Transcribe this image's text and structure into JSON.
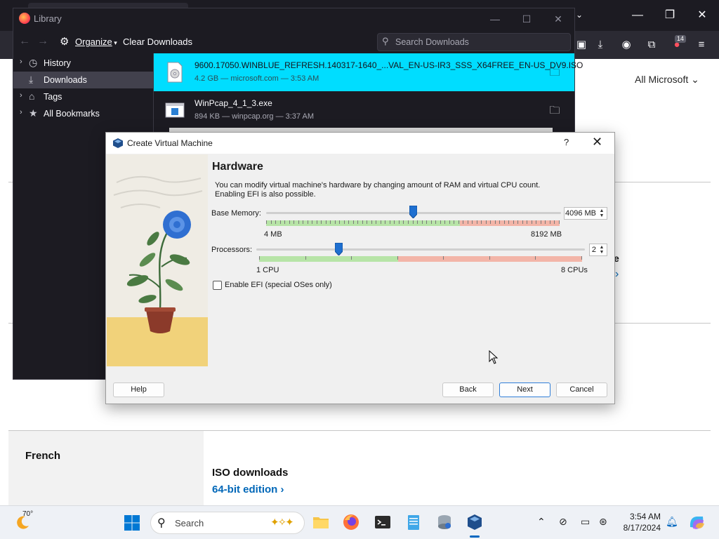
{
  "browser": {
    "title_buttons": {
      "minimize": "—",
      "maximize": "❐",
      "close": "✕"
    },
    "toolbar_badge": "14",
    "ms_page": {
      "all_microsoft": "All Microsoft",
      "partial_heading": "e",
      "french": "French",
      "iso_downloads": "ISO downloads",
      "edition_link": "64-bit edition"
    }
  },
  "library": {
    "title": "Library",
    "toolbar": {
      "organize": "Organize",
      "clear_downloads": "Clear Downloads",
      "search_placeholder": "Search Downloads"
    },
    "sidebar": [
      {
        "label": "History",
        "icon": "clock-icon"
      },
      {
        "label": "Downloads",
        "icon": "download-icon"
      },
      {
        "label": "Tags",
        "icon": "tag-icon"
      },
      {
        "label": "All Bookmarks",
        "icon": "star-icon"
      }
    ],
    "downloads": [
      {
        "name": "9600.17050.WINBLUE_REFRESH.140317-1640_...VAL_EN-US-IR3_SSS_X64FREE_EN-US_DV9.ISO",
        "meta": "4.2 GB — microsoft.com — 3:53 AM"
      },
      {
        "name": "WinPcap_4_1_3.exe",
        "meta": "894 KB — winpcap.org — 3:37 AM"
      }
    ]
  },
  "dialog": {
    "title": "Create Virtual Machine",
    "help_glyph": "?",
    "heading": "Hardware",
    "description": "You can modify virtual machine's hardware by changing amount of RAM and virtual CPU count. Enabling EFI is also possible.",
    "base_memory": {
      "label": "Base Memory:",
      "value": 4096,
      "value_text": "4096 MB",
      "min_label": "4 MB",
      "max_label": "8192 MB",
      "min": 4,
      "max": 8192
    },
    "processors": {
      "label": "Processors:",
      "value": 2,
      "value_text": "2",
      "min_label": "1 CPU",
      "max_label": "8 CPUs",
      "min": 1,
      "max": 8
    },
    "efi": {
      "label": "Enable EFI (special OSes only)",
      "checked": false
    },
    "buttons": {
      "help": "Help",
      "back": "Back",
      "next": "Next",
      "cancel": "Cancel"
    }
  },
  "taskbar": {
    "temperature": "70°",
    "search_label": "Search",
    "time": "3:54 AM",
    "date": "8/17/2024",
    "apps": [
      "file-explorer-icon",
      "firefox-icon",
      "terminal-icon",
      "notepad-icon",
      "disk-utility-icon",
      "virtualbox-icon"
    ]
  },
  "colors": {
    "selected_row": "#00ddff",
    "library_bg": "#1c1b22",
    "accent_blue": "#0067b8",
    "slider_handle": "#1e6fd0",
    "scale_green": "#b7e4a7",
    "scale_red": "#f3b5a8"
  }
}
